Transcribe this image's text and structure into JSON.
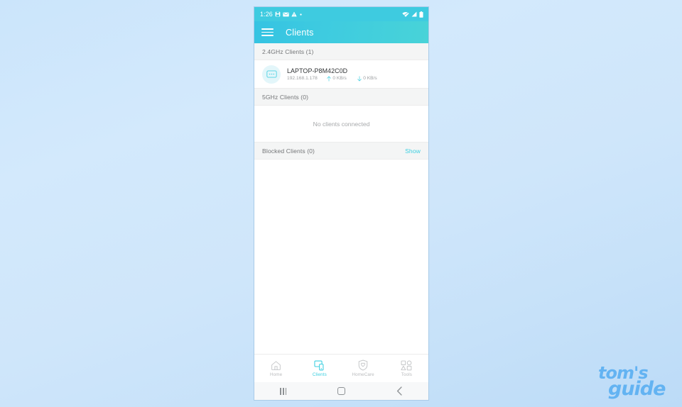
{
  "status_bar": {
    "time": "1:26",
    "left_icons": [
      "save-icon",
      "email-icon",
      "warning-icon",
      "dot-icon"
    ],
    "right_icons": [
      "wifi-icon",
      "cellular-signal-icon",
      "battery-icon"
    ]
  },
  "app_bar": {
    "menu_icon": "hamburger-menu-icon",
    "title": "Clients"
  },
  "sections": [
    {
      "id": "band-24",
      "header": "2.4GHz Clients (1)",
      "action": null,
      "clients": [
        {
          "icon": "device-laptop-icon",
          "name": "LAPTOP-P8M42C0D",
          "ip": "192.168.1.178",
          "upload": "0 KB/s",
          "download": "0 KB/s"
        }
      ],
      "empty_text": null
    },
    {
      "id": "band-5",
      "header": "5GHz Clients (0)",
      "action": null,
      "clients": [],
      "empty_text": "No clients connected"
    },
    {
      "id": "blocked",
      "header": "Blocked Clients (0)",
      "action": "Show",
      "clients": [],
      "empty_text": null
    }
  ],
  "tab_bar": {
    "items": [
      {
        "icon": "home-icon",
        "label": "Home",
        "active": false
      },
      {
        "icon": "devices-icon",
        "label": "Clients",
        "active": true
      },
      {
        "icon": "shield-heart-icon",
        "label": "HomeCare",
        "active": false
      },
      {
        "icon": "tools-grid-icon",
        "label": "Tools",
        "active": false
      }
    ]
  },
  "android_nav": {
    "recents": "recent-apps-icon",
    "home": "android-home-icon",
    "back": "back-chevron-icon"
  },
  "watermark": {
    "line1": "tom's",
    "line2": "guide"
  },
  "colors": {
    "accent": "#3ccfe0",
    "appbar_start": "#35c3e2",
    "appbar_end": "#48d3d8",
    "section_bg": "#f4f5f5",
    "muted_text": "#9b9ea0",
    "logo": "#63b3f2"
  }
}
